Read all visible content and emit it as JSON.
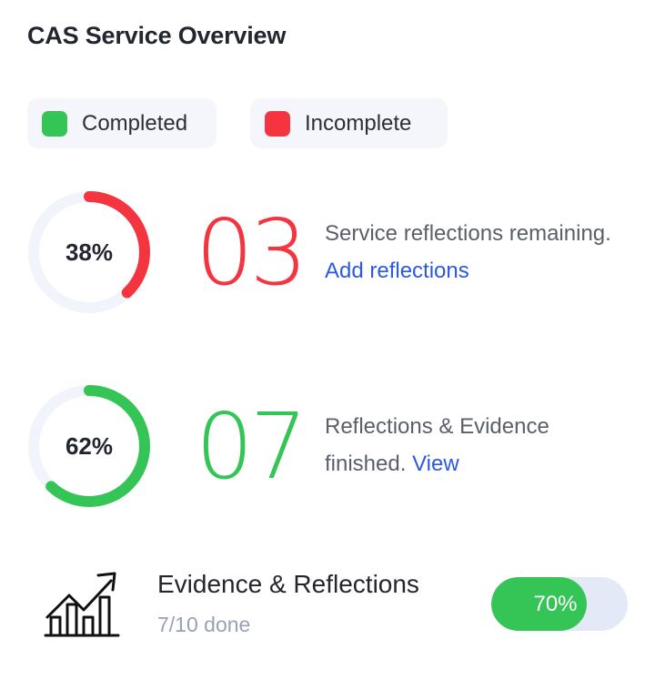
{
  "title": "CAS Service Overview",
  "colors": {
    "completed": "#35c556",
    "incomplete": "#f4343e",
    "track": "#f1f4fb",
    "link": "#2b59e0"
  },
  "legend": [
    {
      "label": "Completed",
      "color": "#35c556"
    },
    {
      "label": "Incomplete",
      "color": "#f4343e"
    }
  ],
  "stats": [
    {
      "percent": 38,
      "percent_label": "38%",
      "color": "#f4343e",
      "number": "03",
      "text": "Service reflections remaining.",
      "link": "Add reflections"
    },
    {
      "percent": 62,
      "percent_label": "62%",
      "color": "#35c556",
      "number": "07",
      "text": "Reflections & Evidence finished.",
      "link": "View"
    }
  ],
  "evidence": {
    "icon": "growth-chart-icon",
    "title": "Evidence & Reflections",
    "subtitle": "7/10 done",
    "progress": 0.7,
    "progress_label": "70%"
  }
}
